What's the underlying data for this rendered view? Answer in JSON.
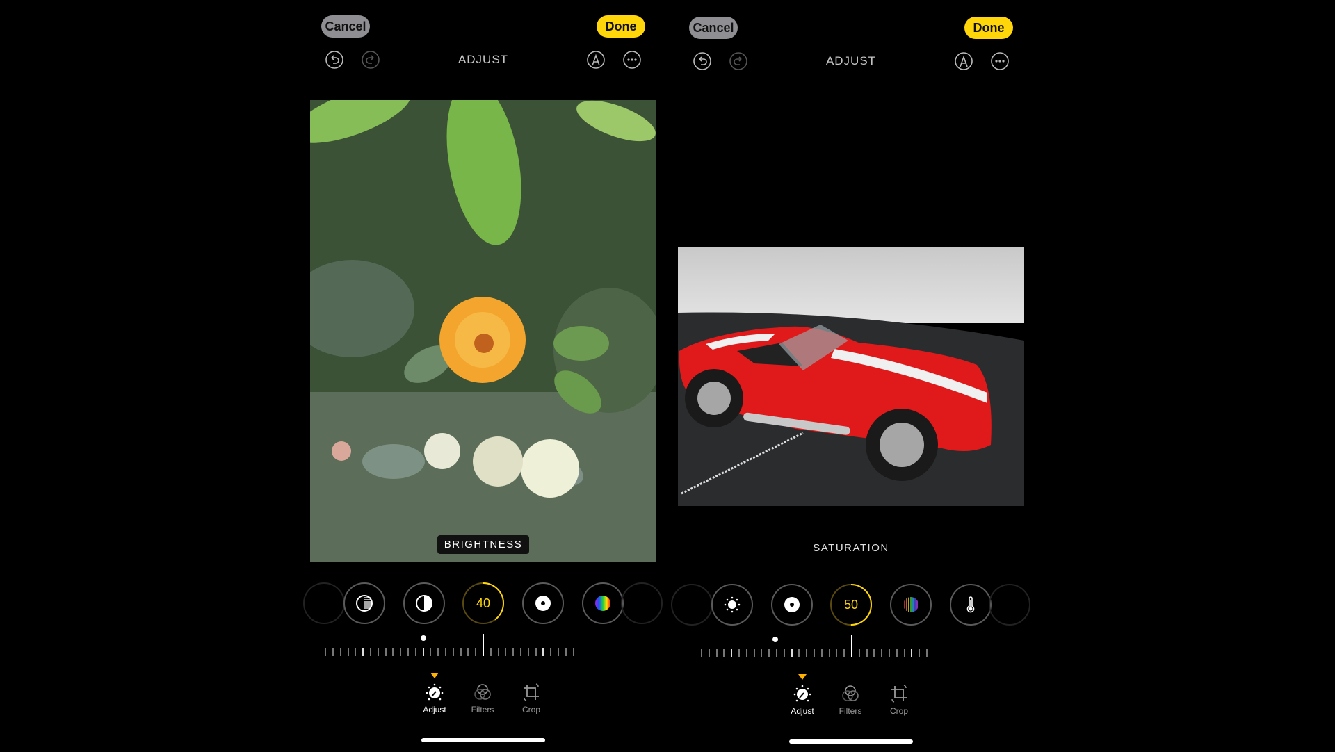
{
  "colors": {
    "accent": "#ffd60a",
    "cancel_bg": "#8e8e93",
    "indicator": "#ffb000"
  },
  "panels": [
    {
      "cancel_label": "Cancel",
      "done_label": "Done",
      "title": "ADJUST",
      "toolbar_icons": [
        "undo-icon",
        "redo-icon",
        "markup-icon",
        "more-icon"
      ],
      "photo": "flower",
      "overlay_label": "BRIGHTNESS",
      "tools": [
        "highlights-icon",
        "contrast-icon",
        "brightness-icon",
        "black-point-icon",
        "saturation-icon"
      ],
      "active_tool_value": "40",
      "active_value_fraction": 0.4,
      "tabs": [
        {
          "label": "Adjust",
          "icon": "adjust-dial-icon",
          "active": true
        },
        {
          "label": "Filters",
          "icon": "filters-icon"
        },
        {
          "label": "Crop",
          "icon": "crop-icon"
        }
      ]
    },
    {
      "cancel_label": "Cancel",
      "done_label": "Done",
      "title": "ADJUST",
      "toolbar_icons": [
        "undo-icon",
        "redo-icon",
        "markup-icon",
        "more-icon"
      ],
      "photo": "car",
      "overlay_label": "SATURATION",
      "tools": [
        "brightness-icon",
        "black-point-icon",
        "saturation-icon",
        "vibrance-icon",
        "warmth-icon"
      ],
      "active_tool_value": "50",
      "active_value_fraction": 0.5,
      "tabs": [
        {
          "label": "Adjust",
          "icon": "adjust-dial-icon",
          "active": true
        },
        {
          "label": "Filters",
          "icon": "filters-icon"
        },
        {
          "label": "Crop",
          "icon": "crop-icon"
        }
      ]
    }
  ]
}
